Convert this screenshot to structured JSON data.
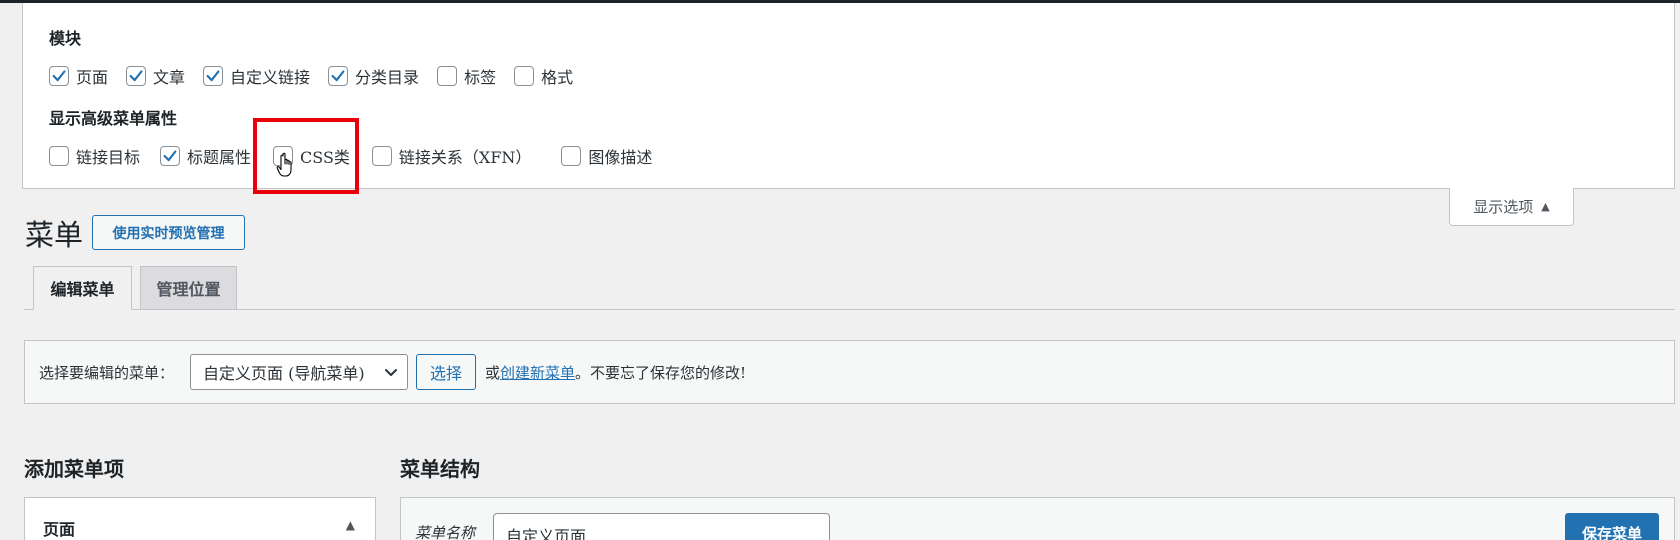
{
  "screen_options": {
    "boxes_title": "模块",
    "boxes": [
      {
        "label": "页面",
        "checked": true
      },
      {
        "label": "文章",
        "checked": true
      },
      {
        "label": "自定义链接",
        "checked": true
      },
      {
        "label": "分类目录",
        "checked": true
      },
      {
        "label": "标签",
        "checked": false
      },
      {
        "label": "格式",
        "checked": false
      }
    ],
    "advanced_title": "显示高级菜单属性",
    "advanced": [
      {
        "label": "链接目标",
        "checked": false
      },
      {
        "label": "标题属性",
        "checked": true
      },
      {
        "label": "CSS类",
        "checked": false
      },
      {
        "label": "链接关系（XFN）",
        "checked": false
      },
      {
        "label": "图像描述",
        "checked": false
      }
    ],
    "toggle_label": "显示选项"
  },
  "header": {
    "title": "菜单",
    "live_preview_label": "使用实时预览管理"
  },
  "tabs": [
    {
      "label": "编辑菜单",
      "active": true
    },
    {
      "label": "管理位置",
      "active": false
    }
  ],
  "manage": {
    "prompt": "选择要编辑的菜单：",
    "selected_menu": "自定义页面 (导航菜单)",
    "select_button": "选择",
    "or_text": "或",
    "create_link": "创建新菜单",
    "reminder": "。不要忘了保存您的修改!"
  },
  "add_items": {
    "title": "添加菜单项",
    "first_panel": "页面"
  },
  "structure": {
    "title": "菜单结构",
    "name_label": "菜单名称",
    "name_value": "自定义页面",
    "save_label": "保存菜单"
  },
  "colors": {
    "accent": "#2271b1",
    "highlight": "#e8000b"
  }
}
